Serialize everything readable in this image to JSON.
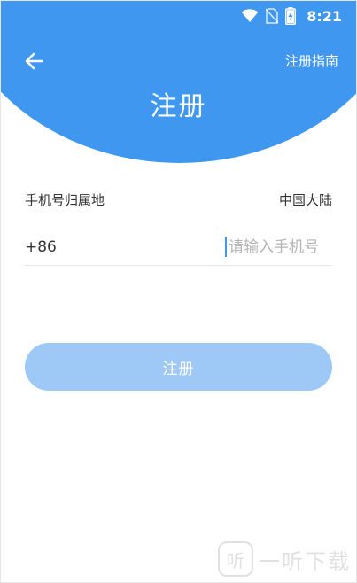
{
  "status_bar": {
    "time": "8:21",
    "icons": [
      "wifi-icon",
      "no-sim-icon",
      "battery-charging-icon"
    ]
  },
  "header": {
    "back_icon": "arrow-left-icon",
    "guide_label": "注册指南",
    "title": "注册",
    "accent_color": "#3f97f0"
  },
  "form": {
    "region_label": "手机号归属地",
    "region_value": "中国大陆",
    "country_code": "+86",
    "phone_placeholder": "请输入手机号",
    "phone_value": ""
  },
  "register_button": {
    "label": "注册",
    "color": "#9ec9f6"
  },
  "watermark": {
    "badge_text": "听",
    "text": "一听下载"
  }
}
